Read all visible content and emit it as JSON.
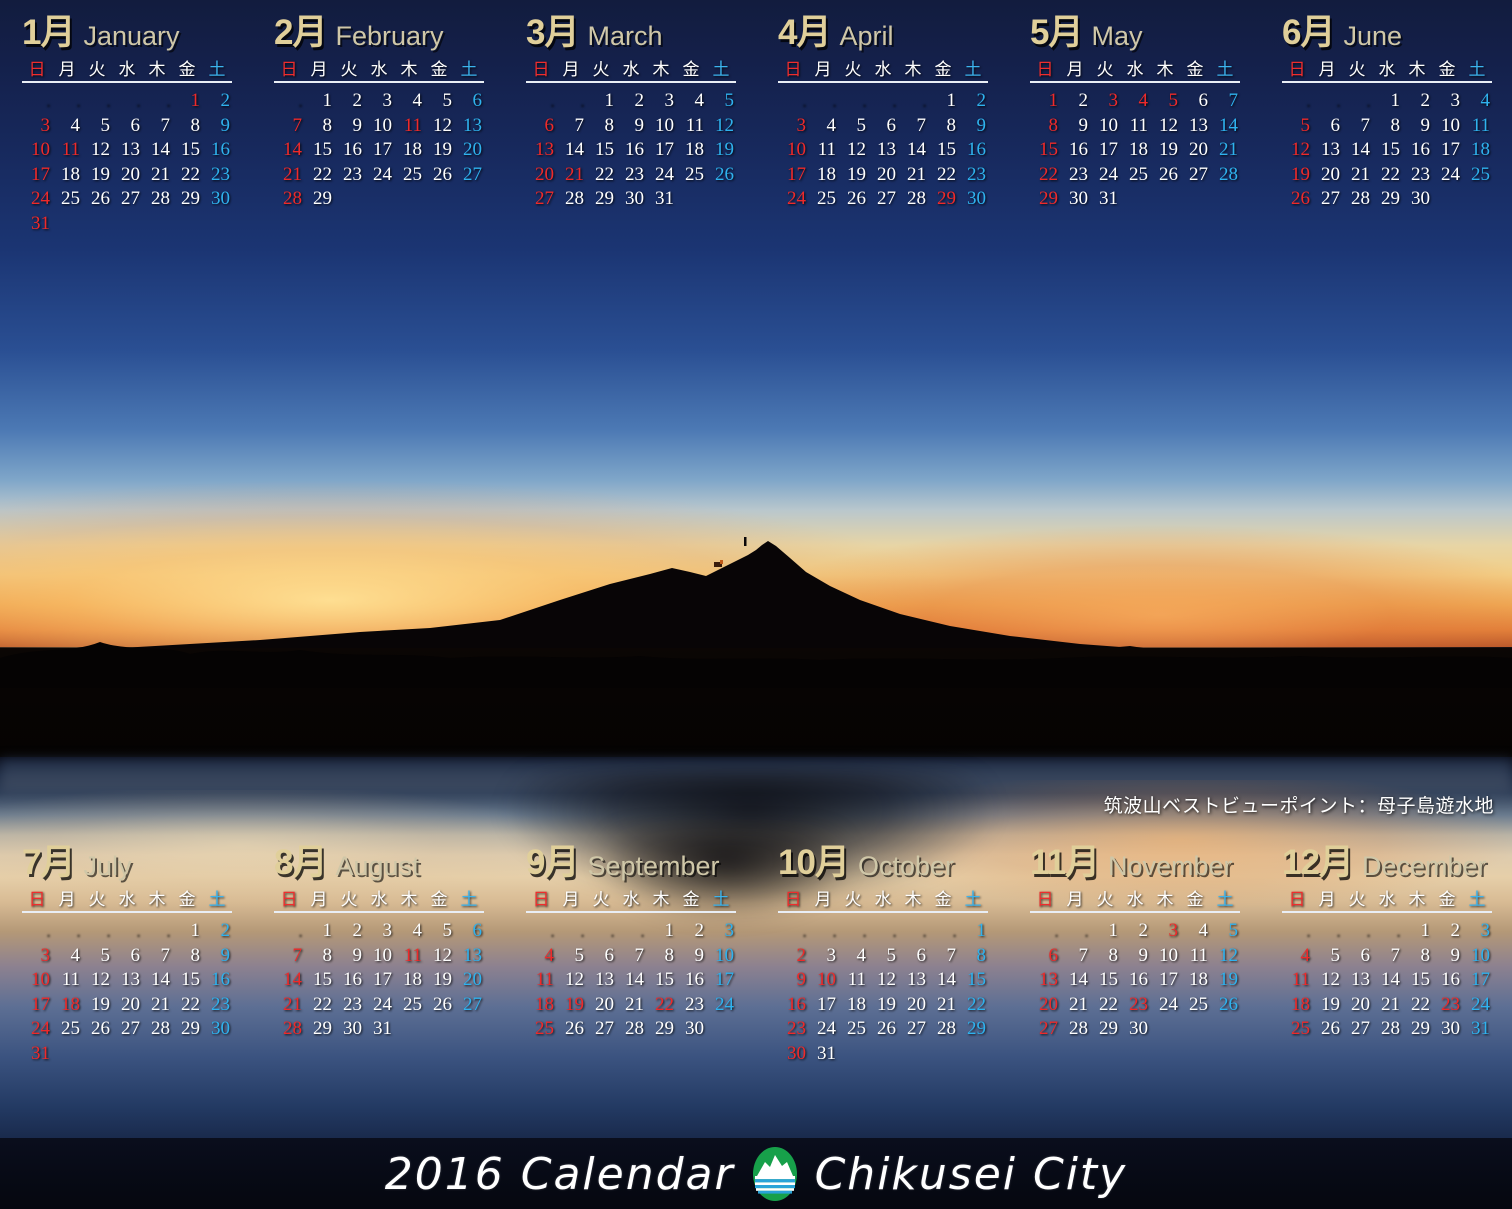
{
  "poster": {
    "title": "2016 Calendar Chikusei City",
    "year": "2016",
    "photo_caption": "筑波山ベストビューポイント：母子島遊水地",
    "background_image_subject": "Mt. Tsukuba silhouette at sunset reflected in Hahakojima retarding basin"
  },
  "colors": {
    "month_gold": "#e0cf9a",
    "month_english": "#cfc7a8",
    "sunday_red": "#ee2a2a",
    "saturday_blue": "#2fb2ee",
    "weekday_white": "#ffffff",
    "logo_green": "#17a04a",
    "logo_blue": "#2aa3d8",
    "sky_top_navy": "#121c3e",
    "horizon_orange": "#f0ab55"
  },
  "weekday_headers": [
    {
      "label": "日",
      "kind": "sun"
    },
    {
      "label": "月",
      "kind": "wd"
    },
    {
      "label": "火",
      "kind": "wd"
    },
    {
      "label": "水",
      "kind": "wd"
    },
    {
      "label": "木",
      "kind": "wd"
    },
    {
      "label": "金",
      "kind": "wd"
    },
    {
      "label": "土",
      "kind": "sat"
    }
  ],
  "footer": {
    "left_text": "2016 Calendar",
    "right_text": "Chikusei City",
    "logo_name": "chikusei-city-logo"
  },
  "months": [
    {
      "num": "1月",
      "en": "January",
      "lead": 5,
      "days": [
        1,
        2,
        3,
        4,
        5,
        6,
        7,
        8,
        9,
        10,
        11,
        12,
        13,
        14,
        15,
        16,
        17,
        18,
        19,
        20,
        21,
        22,
        23,
        24,
        25,
        26,
        27,
        28,
        29,
        30,
        31
      ],
      "holidays": [
        1,
        11
      ]
    },
    {
      "num": "2月",
      "en": "February",
      "lead": 1,
      "days": [
        1,
        2,
        3,
        4,
        5,
        6,
        7,
        8,
        9,
        10,
        11,
        12,
        13,
        14,
        15,
        16,
        17,
        18,
        19,
        20,
        21,
        22,
        23,
        24,
        25,
        26,
        27,
        28,
        29
      ],
      "holidays": [
        11
      ]
    },
    {
      "num": "3月",
      "en": "March",
      "lead": 2,
      "days": [
        1,
        2,
        3,
        4,
        5,
        6,
        7,
        8,
        9,
        10,
        11,
        12,
        13,
        14,
        15,
        16,
        17,
        18,
        19,
        20,
        21,
        22,
        23,
        24,
        25,
        26,
        27,
        28,
        29,
        30,
        31
      ],
      "holidays": [
        20,
        21
      ]
    },
    {
      "num": "4月",
      "en": "April",
      "lead": 5,
      "days": [
        1,
        2,
        3,
        4,
        5,
        6,
        7,
        8,
        9,
        10,
        11,
        12,
        13,
        14,
        15,
        16,
        17,
        18,
        19,
        20,
        21,
        22,
        23,
        24,
        25,
        26,
        27,
        28,
        29,
        30
      ],
      "holidays": [
        29
      ]
    },
    {
      "num": "5月",
      "en": "May",
      "lead": 0,
      "days": [
        1,
        2,
        3,
        4,
        5,
        6,
        7,
        8,
        9,
        10,
        11,
        12,
        13,
        14,
        15,
        16,
        17,
        18,
        19,
        20,
        21,
        22,
        23,
        24,
        25,
        26,
        27,
        28,
        29,
        30,
        31
      ],
      "holidays": [
        3,
        4,
        5
      ]
    },
    {
      "num": "6月",
      "en": "June",
      "lead": 3,
      "days": [
        1,
        2,
        3,
        4,
        5,
        6,
        7,
        8,
        9,
        10,
        11,
        12,
        13,
        14,
        15,
        16,
        17,
        18,
        19,
        20,
        21,
        22,
        23,
        24,
        25,
        26,
        27,
        28,
        29,
        30
      ],
      "holidays": []
    },
    {
      "num": "7月",
      "en": "July",
      "lead": 5,
      "days": [
        1,
        2,
        3,
        4,
        5,
        6,
        7,
        8,
        9,
        10,
        11,
        12,
        13,
        14,
        15,
        16,
        17,
        18,
        19,
        20,
        21,
        22,
        23,
        24,
        25,
        26,
        27,
        28,
        29,
        30,
        31
      ],
      "holidays": [
        18
      ]
    },
    {
      "num": "8月",
      "en": "August",
      "lead": 1,
      "days": [
        1,
        2,
        3,
        4,
        5,
        6,
        7,
        8,
        9,
        10,
        11,
        12,
        13,
        14,
        15,
        16,
        17,
        18,
        19,
        20,
        21,
        22,
        23,
        24,
        25,
        26,
        27,
        28,
        29,
        30,
        31
      ],
      "holidays": [
        11
      ]
    },
    {
      "num": "9月",
      "en": "September",
      "lead": 4,
      "days": [
        1,
        2,
        3,
        4,
        5,
        6,
        7,
        8,
        9,
        10,
        11,
        12,
        13,
        14,
        15,
        16,
        17,
        18,
        19,
        20,
        21,
        22,
        23,
        24,
        25,
        26,
        27,
        28,
        29,
        30
      ],
      "holidays": [
        19,
        22
      ]
    },
    {
      "num": "10月",
      "en": "October",
      "lead": 6,
      "days": [
        1,
        2,
        3,
        4,
        5,
        6,
        7,
        8,
        9,
        10,
        11,
        12,
        13,
        14,
        15,
        16,
        17,
        18,
        19,
        20,
        21,
        22,
        23,
        24,
        25,
        26,
        27,
        28,
        29,
        30,
        31
      ],
      "holidays": [
        10
      ]
    },
    {
      "num": "11月",
      "en": "November",
      "lead": 2,
      "days": [
        1,
        2,
        3,
        4,
        5,
        6,
        7,
        8,
        9,
        10,
        11,
        12,
        13,
        14,
        15,
        16,
        17,
        18,
        19,
        20,
        21,
        22,
        23,
        24,
        25,
        26,
        27,
        28,
        29,
        30
      ],
      "holidays": [
        3,
        23
      ]
    },
    {
      "num": "12月",
      "en": "December",
      "lead": 4,
      "days": [
        1,
        2,
        3,
        4,
        5,
        6,
        7,
        8,
        9,
        10,
        11,
        12,
        13,
        14,
        15,
        16,
        17,
        18,
        19,
        20,
        21,
        22,
        23,
        24,
        25,
        26,
        27,
        28,
        29,
        30,
        31
      ],
      "holidays": [
        23
      ]
    }
  ]
}
